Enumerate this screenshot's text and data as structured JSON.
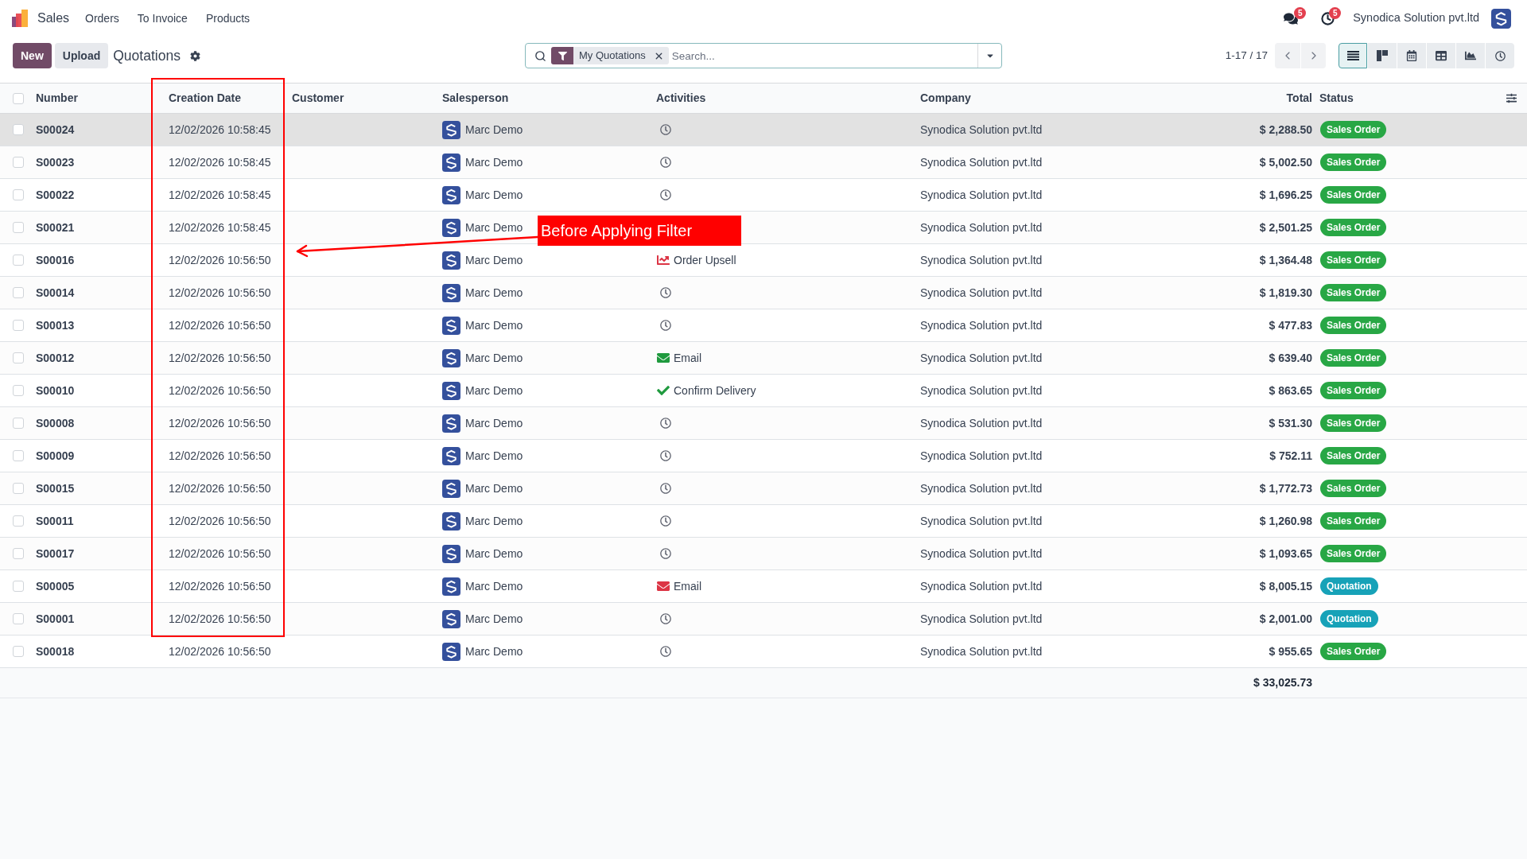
{
  "navbar": {
    "app_name": "Sales",
    "menu": [
      "Orders",
      "To Invoice",
      "Products"
    ],
    "messages_count": "5",
    "activities_count": "5",
    "company": "Synodica Solution pvt.ltd"
  },
  "control_panel": {
    "buttons": [
      {
        "label": "New",
        "kind": "primary"
      },
      {
        "label": "Upload",
        "kind": "secondary"
      }
    ],
    "breadcrumb": "Quotations",
    "search": {
      "facets": [
        {
          "label": "My Quotations"
        }
      ],
      "placeholder": "Search..."
    },
    "pager": "1-17 / 17",
    "views": [
      {
        "kind": "list",
        "selected": true
      },
      {
        "kind": "kanban",
        "selected": false
      },
      {
        "kind": "calendar",
        "selected": false
      },
      {
        "kind": "pivot",
        "selected": false
      },
      {
        "kind": "graph",
        "selected": false
      },
      {
        "kind": "activity",
        "selected": false
      }
    ]
  },
  "table": {
    "select_all": {
      "checked": false
    },
    "columns": [
      "Number",
      "Creation Date",
      "Customer",
      "Salesperson",
      "Activities",
      "Company",
      "Total",
      "Status"
    ],
    "rows": [
      {
        "checked": false,
        "hovered": true,
        "number": "S00024",
        "date": "12/02/2026 10:58:45",
        "salesperson": "Marc Demo",
        "activity": {
          "kind": "none"
        },
        "company": "Synodica Solution pvt.ltd",
        "total": "$ 2,288.50",
        "status": {
          "label": "Sales Order",
          "color": "#28a745"
        }
      },
      {
        "checked": false,
        "hovered": false,
        "number": "S00023",
        "date": "12/02/2026 10:58:45",
        "salesperson": "Marc Demo",
        "activity": {
          "kind": "none"
        },
        "company": "Synodica Solution pvt.ltd",
        "total": "$ 5,002.50",
        "status": {
          "label": "Sales Order",
          "color": "#28a745"
        }
      },
      {
        "checked": false,
        "hovered": false,
        "number": "S00022",
        "date": "12/02/2026 10:58:45",
        "salesperson": "Marc Demo",
        "activity": {
          "kind": "none"
        },
        "company": "Synodica Solution pvt.ltd",
        "total": "$ 1,696.25",
        "status": {
          "label": "Sales Order",
          "color": "#28a745"
        }
      },
      {
        "checked": false,
        "hovered": false,
        "number": "S00021",
        "date": "12/02/2026 10:58:45",
        "salesperson": "Marc Demo",
        "company": "Synodica Solution pvt.ltd",
        "total": "$ 2,501.25",
        "status": {
          "label": "Sales Order",
          "color": "#28a745"
        }
      },
      {
        "checked": false,
        "hovered": false,
        "number": "S00016",
        "date": "12/02/2026 10:56:50",
        "salesperson": "Marc Demo",
        "activity": {
          "kind": "upsell",
          "label": "Order Upsell",
          "color": "#dc3545"
        },
        "company": "Synodica Solution pvt.ltd",
        "total": "$ 1,364.48",
        "status": {
          "label": "Sales Order",
          "color": "#28a745"
        }
      },
      {
        "checked": false,
        "hovered": false,
        "number": "S00014",
        "date": "12/02/2026 10:56:50",
        "salesperson": "Marc Demo",
        "activity": {
          "kind": "none"
        },
        "company": "Synodica Solution pvt.ltd",
        "total": "$ 1,819.30",
        "status": {
          "label": "Sales Order",
          "color": "#28a745"
        }
      },
      {
        "checked": false,
        "hovered": false,
        "number": "S00013",
        "date": "12/02/2026 10:56:50",
        "salesperson": "Marc Demo",
        "activity": {
          "kind": "none"
        },
        "company": "Synodica Solution pvt.ltd",
        "total": "$ 477.83",
        "status": {
          "label": "Sales Order",
          "color": "#28a745"
        }
      },
      {
        "checked": false,
        "hovered": false,
        "number": "S00012",
        "date": "12/02/2026 10:56:50",
        "salesperson": "Marc Demo",
        "activity": {
          "kind": "email",
          "label": "Email",
          "color": "#1f9a3e"
        },
        "company": "Synodica Solution pvt.ltd",
        "total": "$ 639.40",
        "status": {
          "label": "Sales Order",
          "color": "#28a745"
        }
      },
      {
        "checked": false,
        "hovered": false,
        "number": "S00010",
        "date": "12/02/2026 10:56:50",
        "salesperson": "Marc Demo",
        "activity": {
          "kind": "todo",
          "label": "Confirm Delivery",
          "color": "#1f9a3e"
        },
        "company": "Synodica Solution pvt.ltd",
        "total": "$ 863.65",
        "status": {
          "label": "Sales Order",
          "color": "#28a745"
        }
      },
      {
        "checked": false,
        "hovered": false,
        "number": "S00008",
        "date": "12/02/2026 10:56:50",
        "salesperson": "Marc Demo",
        "activity": {
          "kind": "none"
        },
        "company": "Synodica Solution pvt.ltd",
        "total": "$ 531.30",
        "status": {
          "label": "Sales Order",
          "color": "#28a745"
        }
      },
      {
        "checked": false,
        "hovered": false,
        "number": "S00009",
        "date": "12/02/2026 10:56:50",
        "salesperson": "Marc Demo",
        "activity": {
          "kind": "none"
        },
        "company": "Synodica Solution pvt.ltd",
        "total": "$ 752.11",
        "status": {
          "label": "Sales Order",
          "color": "#28a745"
        }
      },
      {
        "checked": false,
        "hovered": false,
        "number": "S00015",
        "date": "12/02/2026 10:56:50",
        "salesperson": "Marc Demo",
        "activity": {
          "kind": "none"
        },
        "company": "Synodica Solution pvt.ltd",
        "total": "$ 1,772.73",
        "status": {
          "label": "Sales Order",
          "color": "#28a745"
        }
      },
      {
        "checked": false,
        "hovered": false,
        "number": "S00011",
        "date": "12/02/2026 10:56:50",
        "salesperson": "Marc Demo",
        "activity": {
          "kind": "none"
        },
        "company": "Synodica Solution pvt.ltd",
        "total": "$ 1,260.98",
        "status": {
          "label": "Sales Order",
          "color": "#28a745"
        }
      },
      {
        "checked": false,
        "hovered": false,
        "number": "S00017",
        "date": "12/02/2026 10:56:50",
        "salesperson": "Marc Demo",
        "activity": {
          "kind": "none"
        },
        "company": "Synodica Solution pvt.ltd",
        "total": "$ 1,093.65",
        "status": {
          "label": "Sales Order",
          "color": "#28a745"
        }
      },
      {
        "checked": false,
        "hovered": false,
        "number": "S00005",
        "date": "12/02/2026 10:56:50",
        "salesperson": "Marc Demo",
        "activity": {
          "kind": "email",
          "label": "Email",
          "color": "#dc3545"
        },
        "company": "Synodica Solution pvt.ltd",
        "total": "$ 8,005.15",
        "status": {
          "label": "Quotation",
          "color": "#17a2b8"
        }
      },
      {
        "checked": false,
        "hovered": false,
        "number": "S00001",
        "date": "12/02/2026 10:56:50",
        "salesperson": "Marc Demo",
        "activity": {
          "kind": "none"
        },
        "company": "Synodica Solution pvt.ltd",
        "total": "$ 2,001.00",
        "status": {
          "label": "Quotation",
          "color": "#17a2b8"
        }
      },
      {
        "checked": false,
        "hovered": false,
        "number": "S00018",
        "date": "12/02/2026 10:56:50",
        "salesperson": "Marc Demo",
        "activity": {
          "kind": "none"
        },
        "company": "Synodica Solution pvt.ltd",
        "total": "$ 955.65",
        "status": {
          "label": "Sales Order",
          "color": "#28a745"
        }
      }
    ],
    "footer_total": "$ 33,025.73"
  },
  "annotation": {
    "label": "Before Applying Filter"
  }
}
